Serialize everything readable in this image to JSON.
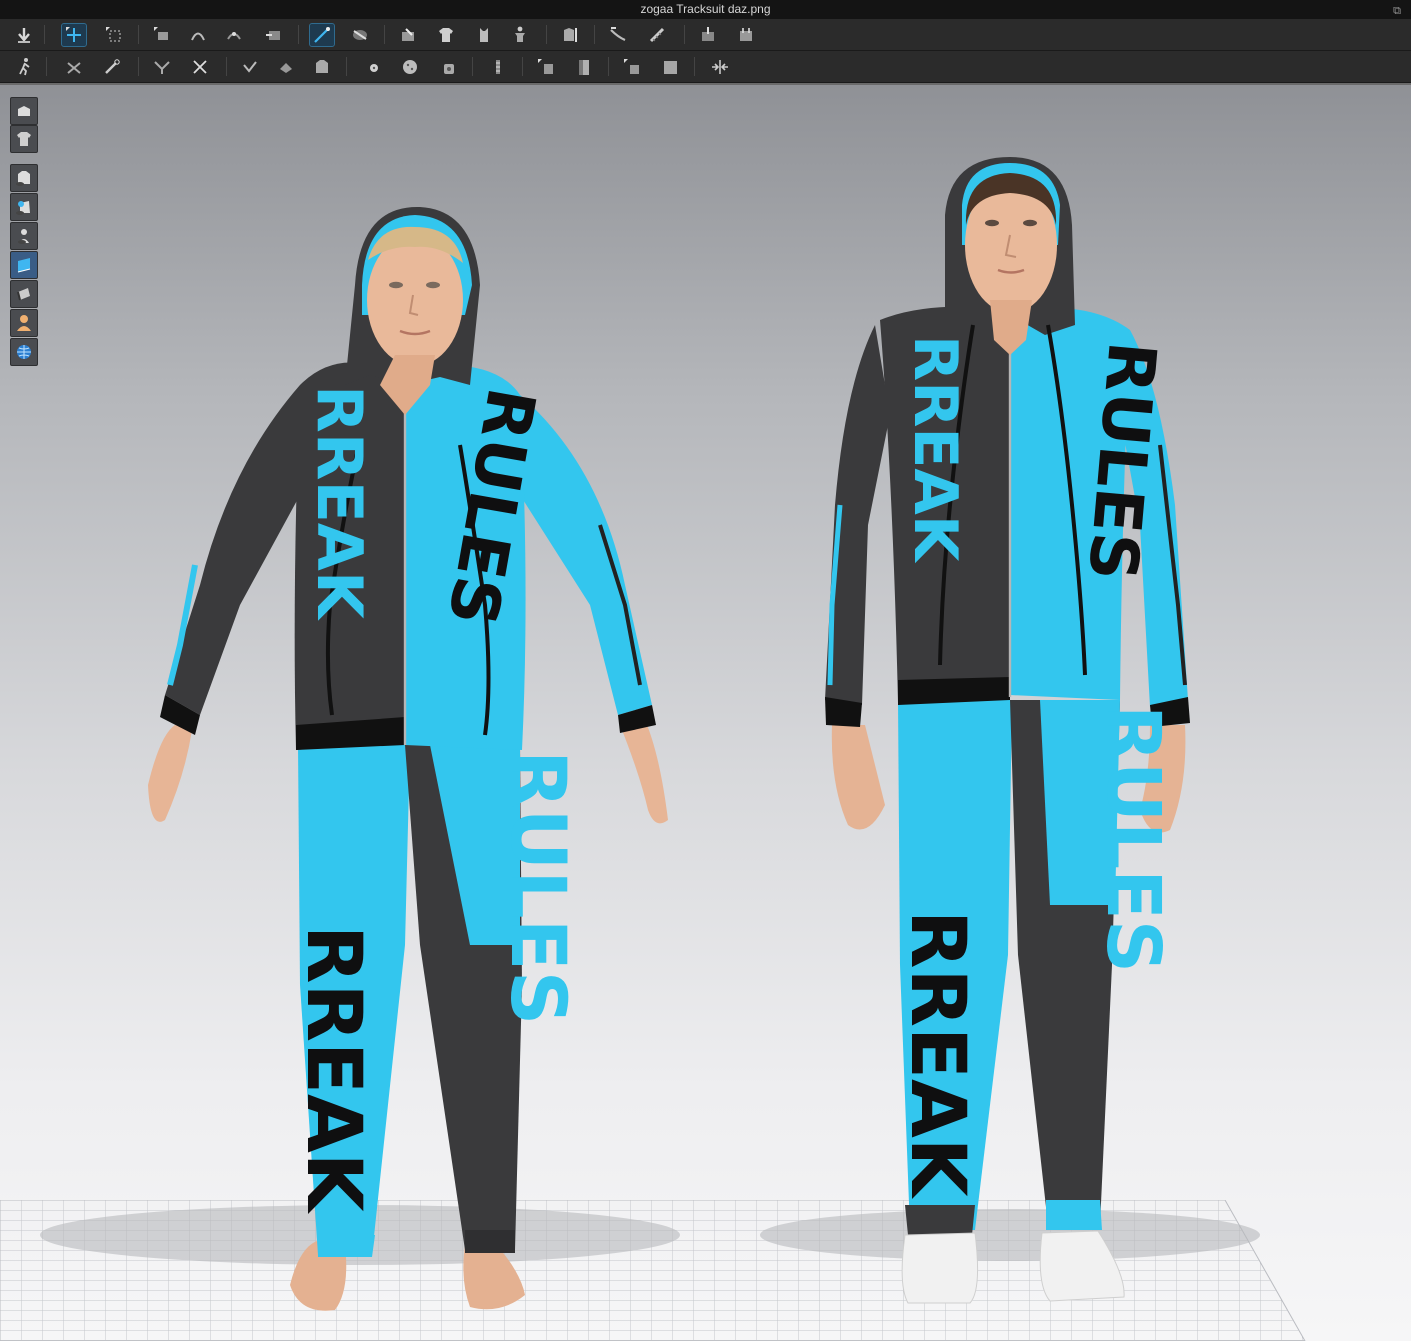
{
  "window": {
    "title": "zogaa Tracksuit daz.png"
  },
  "toolbar_row1": [
    "import-arrow",
    "transform-pattern",
    "select-box",
    "segment-tool",
    "edit-curve",
    "curve-point",
    "add-point",
    "select-mesh",
    "fold-arrange",
    "fold-tack",
    "sewing",
    "avatar-measure",
    "arrangement",
    "tack",
    "gather",
    "tape-measure",
    "ruler",
    "pin",
    "pin-box"
  ],
  "toolbar_row2": [
    "walk-pose",
    "edit-pattern",
    "trim",
    "avatar-cut",
    "zipper",
    "button",
    "buttonhole",
    "select-button",
    "button-tool",
    "topstitch",
    "zip-puller",
    "fold-line",
    "fold-curve",
    "fitting",
    "pressing",
    "thickness"
  ],
  "side_toolbar": [
    "avatar-view-icon",
    "garment-view-icon",
    "eye-show-garment-icon",
    "eye-show-avatar-icon",
    "eye-show-skeleton-icon",
    "texture-view-icon",
    "render-mode-icon",
    "avatar-skin-icon",
    "mesh-globe-icon"
  ],
  "scene": {
    "colors": {
      "cyan": "#33c6ee",
      "dark": "#3a3a3c",
      "black": "#0f0f10",
      "skin": "#e9b99a",
      "hair": "#d6b888",
      "hair_dark": "#4a3426",
      "sneaker": "#f1f1f1"
    },
    "print_text": [
      "RULES",
      "RREAK"
    ]
  }
}
